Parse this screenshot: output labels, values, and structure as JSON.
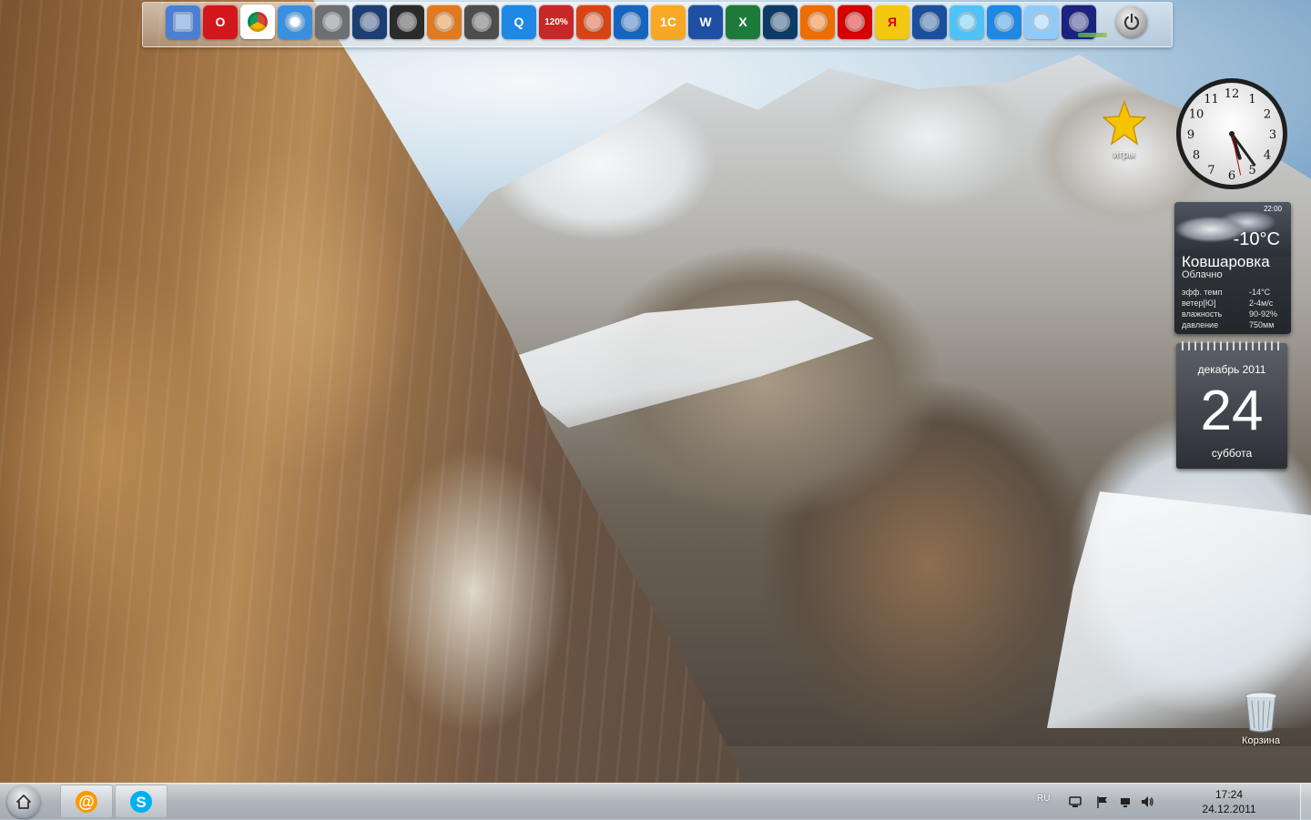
{
  "dock": {
    "apps": [
      {
        "name": "finder-icon",
        "label": "",
        "bg": "#4a7fd4"
      },
      {
        "name": "opera-icon",
        "label": "O",
        "bg": "#d3161c"
      },
      {
        "name": "chrome-icon",
        "label": "",
        "bg": "#ffffff"
      },
      {
        "name": "safari-icon",
        "label": "",
        "bg": "#3b8fe0"
      },
      {
        "name": "system-settings-icon",
        "label": "",
        "bg": "#6d6f73"
      },
      {
        "name": "display-icon",
        "label": "",
        "bg": "#1d3e73"
      },
      {
        "name": "video-editor-icon",
        "label": "",
        "bg": "#2b2b2b"
      },
      {
        "name": "photo-viewer-icon",
        "label": "",
        "bg": "#e07a1f"
      },
      {
        "name": "camera-icon",
        "label": "",
        "bg": "#4d4d4d"
      },
      {
        "name": "quicktime-icon",
        "label": "Q",
        "bg": "#1e88e5"
      },
      {
        "name": "acrobat-icon",
        "label": "120%",
        "bg": "#c62828"
      },
      {
        "name": "radio-icon",
        "label": "",
        "bg": "#d84315"
      },
      {
        "name": "lightning-icon",
        "label": "",
        "bg": "#1565c0"
      },
      {
        "name": "1c-icon",
        "label": "1С",
        "bg": "#f9a825"
      },
      {
        "name": "word-icon",
        "label": "W",
        "bg": "#1e4fa3"
      },
      {
        "name": "excel-icon",
        "label": "X",
        "bg": "#1e7a3a"
      },
      {
        "name": "media-player-icon",
        "label": "",
        "bg": "#0d3b66"
      },
      {
        "name": "arrow-app-icon",
        "label": "",
        "bg": "#ef6c00"
      },
      {
        "name": "spin-app-icon",
        "label": "",
        "bg": "#d50000"
      },
      {
        "name": "yandex-icon",
        "label": "Я",
        "bg": "#f2c811"
      },
      {
        "name": "google-earth-icon",
        "label": "",
        "bg": "#1a4f9c"
      },
      {
        "name": "window-app-icon",
        "label": "",
        "bg": "#4fc3f7"
      },
      {
        "name": "network-icon",
        "label": "",
        "bg": "#1e88e5"
      },
      {
        "name": "cleaner-icon",
        "label": "",
        "bg": "#90caf9"
      },
      {
        "name": "control-panel-icon",
        "label": "",
        "bg": "#1a237e"
      }
    ]
  },
  "desktop": {
    "games_label": "игры",
    "recycle_label": "Корзина"
  },
  "weather": {
    "time": "22:00",
    "temp": "-10°C",
    "city": "Ковшаровка",
    "condition": "Облачно",
    "rows": [
      {
        "label": "эфф. темп",
        "value": "-14°C"
      },
      {
        "label": "ветер[Ю]",
        "value": "2-4м/с"
      },
      {
        "label": "влажность",
        "value": "90-92%"
      },
      {
        "label": "давление",
        "value": "750мм"
      }
    ]
  },
  "calendar": {
    "month": "декабрь 2011",
    "day": "24",
    "weekday": "суббота"
  },
  "clock_gadget": {
    "hour": 5,
    "minute": 24,
    "second": 28,
    "numerals": [
      "12",
      "1",
      "2",
      "3",
      "4",
      "5",
      "6",
      "7",
      "8",
      "9",
      "10",
      "11"
    ]
  },
  "taskbar": {
    "lang": "RU",
    "time": "17:24",
    "date": "24.12.2011"
  },
  "colors": {
    "accent": "#f5c400",
    "taskbar_text": "#111111"
  }
}
